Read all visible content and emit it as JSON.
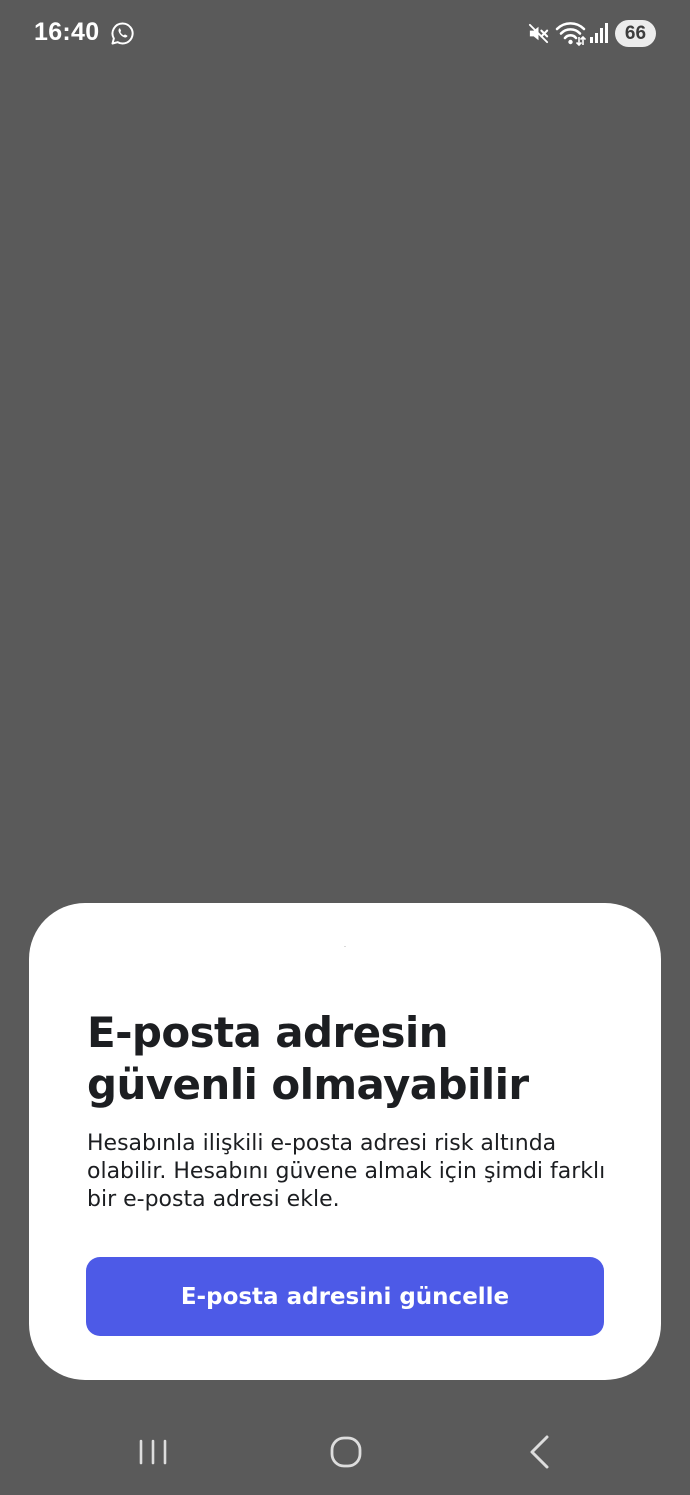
{
  "status_bar": {
    "time": "16:40",
    "notification_icon": "whatsapp-icon",
    "icons": [
      "mute-icon",
      "wifi-icon",
      "signal-icon"
    ],
    "battery": "66"
  },
  "sheet": {
    "title": "E-posta adresin güvenli olmayabilir",
    "body": "Hesabınla ilişkili e-posta adresi risk altında olabilir. Hesabını güvene almak için şimdi farklı bir e-posta adresi ekle.",
    "button_label": "E-posta adresini güncelle"
  },
  "nav_bar": {
    "buttons": [
      "recents-icon",
      "home-icon",
      "back-icon"
    ]
  },
  "colors": {
    "background": "#5a5a5a",
    "sheet": "#ffffff",
    "button": "#4d5ae7",
    "text": "#1c1e21"
  }
}
